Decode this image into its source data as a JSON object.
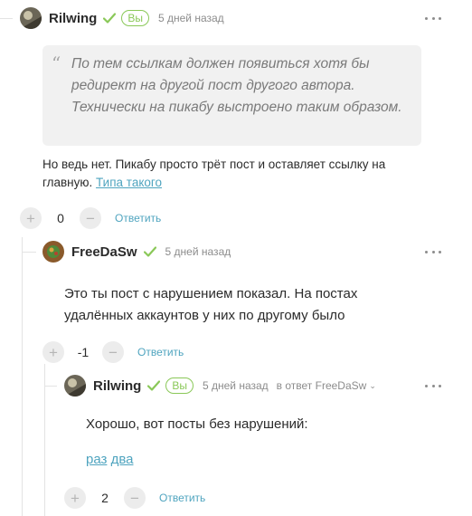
{
  "verified_color": "#8ac858",
  "link_color": "#4fa4bf",
  "comments": [
    {
      "author": "Rilwing",
      "badge": "Вы",
      "time": "5 дней назад",
      "quote": "По тем ссылкам должен появиться хотя бы редирект на другой пост другого автора. Технически на пикабу выстроено таким образом.",
      "text_prefix": "Но ведь нет. Пикабу просто трёт пост и оставляет ссылку на главную.",
      "link": "Типа такого",
      "score": "0",
      "reply": "Ответить",
      "more_icon": "more-dots-icon"
    },
    {
      "author": "FreeDaSw",
      "time": "5 дней назад",
      "text": "Это ты пост с нарушением показал. На постах удалённых аккаунтов у них по другому было",
      "score": "-1",
      "reply": "Ответить",
      "more_icon": "more-dots-icon"
    },
    {
      "author": "Rilwing",
      "badge": "Вы",
      "time": "5 дней назад",
      "reply_to": "в ответ FreeDaSw",
      "text": "Хорошо, вот посты без нарушений:",
      "link1": "раз",
      "link2": "два",
      "score": "2",
      "reply": "Ответить",
      "more_icon": "more-dots-icon"
    }
  ]
}
